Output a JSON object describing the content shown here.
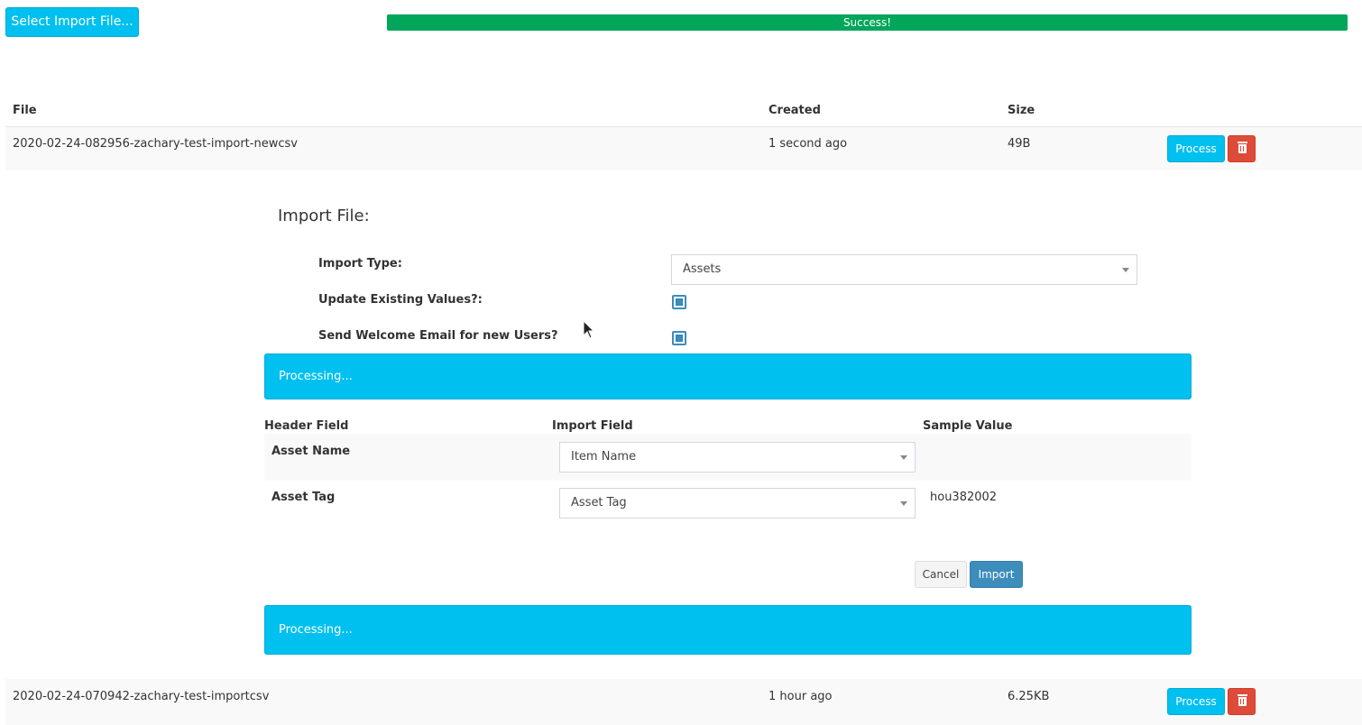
{
  "toolbar": {
    "select_file_label": "Select Import File...",
    "progress": {
      "text": "Success!",
      "percent": 100,
      "color": "#00a65a"
    }
  },
  "files_table": {
    "headers": {
      "file": "File",
      "created": "Created",
      "size": "Size"
    },
    "rows": [
      {
        "file": "2020-02-24-082956-zachary-test-import-newcsv",
        "created": "1 second ago",
        "size": "49B",
        "process_label": "Process"
      },
      {
        "file": "2020-02-24-070942-zachary-test-importcsv",
        "created": "1 hour ago",
        "size": "6.25KB",
        "process_label": "Process"
      }
    ]
  },
  "import_form": {
    "title": "Import File:",
    "import_type_label": "Import Type:",
    "import_type_value": "Assets",
    "update_existing_label": "Update Existing Values?:",
    "update_existing_checked": true,
    "send_welcome_label": "Send Welcome Email for new Users?",
    "send_welcome_checked": true,
    "processing_text": "Processing...",
    "mapping_headers": {
      "header_field": "Header Field",
      "import_field": "Import Field",
      "sample_value": "Sample Value"
    },
    "mapping_rows": [
      {
        "header": "Asset Name",
        "import_field": "Item Name",
        "sample": ""
      },
      {
        "header": "Asset Tag",
        "import_field": "Asset Tag",
        "sample": "hou382002"
      }
    ],
    "cancel_label": "Cancel",
    "import_label": "Import",
    "processing_text_bottom": "Processing..."
  },
  "colors": {
    "info": "#00c0ef",
    "danger": "#dd4b39",
    "primary": "#3c8dbc",
    "success": "#00a65a"
  }
}
